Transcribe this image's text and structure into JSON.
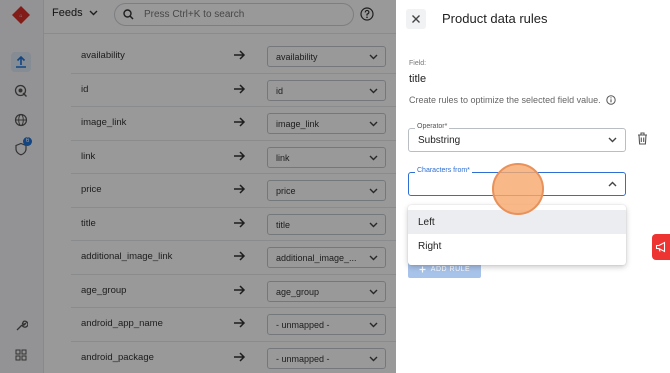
{
  "topbar": {
    "feeds_label": "Feeds",
    "search_placeholder": "Press Ctrl+K to search"
  },
  "rail": {
    "icons": [
      "app-logo-icon",
      "export-icon",
      "radar-icon",
      "globe-icon",
      "shield-icon",
      "wrench-icon",
      "grid-icon"
    ],
    "active": "export-icon",
    "badge": "6"
  },
  "mappings": [
    {
      "field": "availability",
      "target": "availability"
    },
    {
      "field": "id",
      "target": "id"
    },
    {
      "field": "image_link",
      "target": "image_link"
    },
    {
      "field": "link",
      "target": "link"
    },
    {
      "field": "price",
      "target": "price"
    },
    {
      "field": "title",
      "target": "title"
    },
    {
      "field": "additional_image_link",
      "target": "additional_image_..."
    },
    {
      "field": "age_group",
      "target": "age_group"
    },
    {
      "field": "android_app_name",
      "target": "- unmapped -"
    },
    {
      "field": "android_package",
      "target": "- unmapped -"
    }
  ],
  "panel": {
    "title": "Product data rules",
    "field_label": "Field:",
    "field_value": "title",
    "hint": "Create rules to optimize the selected field value.",
    "operator_label": "Operator*",
    "operator_value": "Substring",
    "chars_label": "Characters from*",
    "chars_value": "",
    "add_rule": "ADD RULE"
  },
  "dropdown": {
    "options": [
      "Left",
      "Right"
    ],
    "highlighted": "Left"
  },
  "colors": {
    "accent": "#2f6fd4",
    "cursor": "#f6a86e",
    "feedback": "#e33333"
  }
}
